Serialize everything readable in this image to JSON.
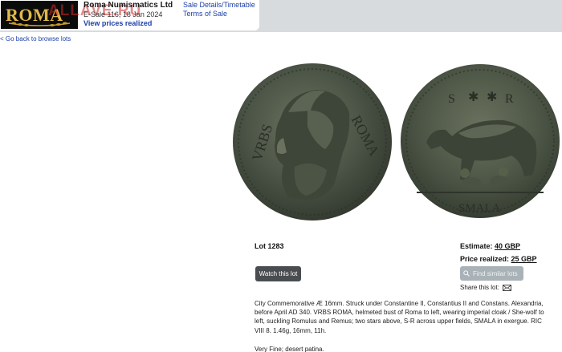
{
  "header": {
    "logo_text": "ROMA",
    "watermark": "ALLAVE.RU",
    "auction_house": "Roma Numismatics Ltd",
    "sale_info": "E-Sale 116, 18 Jan 2024",
    "view_prices": "View prices realized",
    "sale_details": "Sale Details/Timetable",
    "terms": "Terms of Sale"
  },
  "nav": {
    "back_link": "< Go back to browse lots"
  },
  "coin": {
    "obverse_legend": "VRBS ROMA",
    "reverse_legend": "S * * R",
    "exergue": "SMALA"
  },
  "lot": {
    "number": "Lot 1283",
    "estimate_label": "Estimate:",
    "estimate_value": "40 GBP",
    "realized_label": "Price realized:",
    "realized_value": "25 GBP",
    "watch_label": "Watch this lot",
    "similar_label": "Find similar lots",
    "share_label": "Share this lot:",
    "description": "City Commemorative Æ 16mm. Struck under Constantine II, Constantius II and Constans. Alexandria, before April AD 340. VRBS ROMA, helmeted bust of Roma to left, wearing imperial cloak / She-wolf to left, suckling Romulus and Remus; two stars above, S-R across upper fields, SMALA in exergue. RIC VIII 8. 1.46g, 16mm, 11h.",
    "grade": "Very Fine; desert patina."
  },
  "colors": {
    "link": "#1c3fa6",
    "header_bg": "#d8dbdd",
    "logo_gold": "#e1b94a",
    "coin_patina": "#4f5a4c"
  },
  "icons": [
    "search-icon",
    "mail-icon",
    "laurel-icon"
  ]
}
